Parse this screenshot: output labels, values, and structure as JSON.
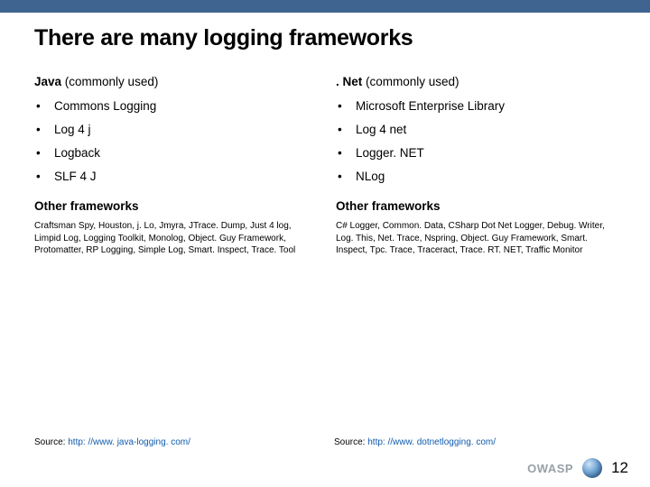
{
  "title": "There are many logging frameworks",
  "left": {
    "heading_bold": "Java",
    "heading_rest": " (commonly used)",
    "items": [
      "Commons Logging",
      "Log 4 j",
      "Logback",
      "SLF 4 J"
    ],
    "other_heading": "Other frameworks",
    "other_text": "Craftsman Spy, Houston, j. Lo, Jmyra, JTrace. Dump, Just 4 log, Limpid Log, Logging Toolkit, Monolog, Object. Guy Framework, Protomatter, RP Logging, Simple Log, Smart. Inspect, Trace. Tool",
    "source_label": "Source: ",
    "source_url": "http: //www. java-logging. com/"
  },
  "right": {
    "heading_bold": ". Net",
    "heading_rest": " (commonly used)",
    "items": [
      "Microsoft Enterprise Library",
      "Log 4 net",
      "Logger. NET",
      "NLog"
    ],
    "other_heading": "Other frameworks",
    "other_text": "C# Logger, Common. Data, CSharp Dot Net Logger, Debug. Writer, Log. This, Net. Trace, Nspring, Object. Guy Framework, Smart. Inspect, Tpc. Trace, Traceract, Trace. RT. NET, Traffic Monitor",
    "source_label": "Source: ",
    "source_url": "http: //www. dotnetlogging. com/"
  },
  "footer": {
    "owasp": "OWASP",
    "page": "12"
  }
}
